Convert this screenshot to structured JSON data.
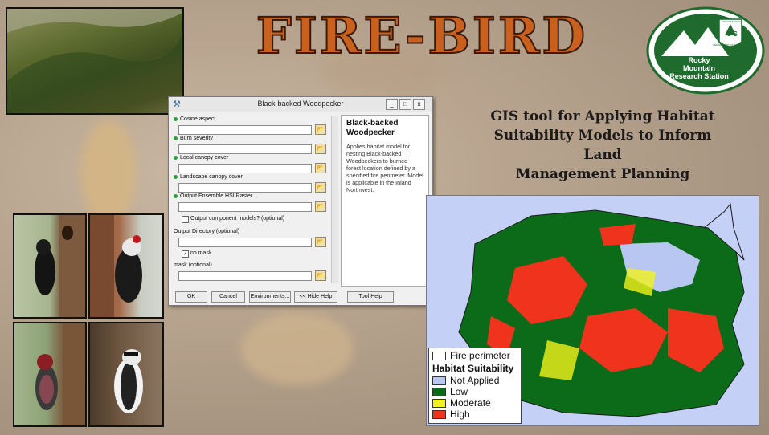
{
  "title": "FIRE-BIRD",
  "subtitle": [
    "GIS tool for Applying Habitat",
    "Suitability Models to Inform Land",
    "Management Planning"
  ],
  "logo": {
    "shield_text": "U S",
    "arc_text_top": "FOREST SERVICE",
    "arc_text_side": "DEPARTMENT OF AGRICULTURE",
    "name_lines": [
      "Rocky",
      "Mountain",
      "Research Station"
    ],
    "colors": {
      "green": "#1f6b2e",
      "white": "#ffffff"
    }
  },
  "dialog": {
    "title": "Black-backed Woodpecker",
    "app_icon": "toolbox-icon",
    "window_buttons": [
      "_",
      "□",
      "x"
    ],
    "fields": [
      {
        "label": "Cosine aspect",
        "required": true,
        "value": ""
      },
      {
        "label": "Burn severity",
        "required": true,
        "value": ""
      },
      {
        "label": "Local canopy cover",
        "required": true,
        "value": ""
      },
      {
        "label": "Landscape canopy cover",
        "required": true,
        "value": ""
      },
      {
        "label": "Output Ensemble HSI Raster",
        "required": true,
        "value": ""
      }
    ],
    "checkbox_component": {
      "label": "Output component models? (optional)",
      "checked": false
    },
    "output_directory": {
      "label": "Output Directory (optional)",
      "value": ""
    },
    "checkbox_nomask": {
      "label": "no mask",
      "checked": true
    },
    "mask": {
      "label": "mask (optional)",
      "value": ""
    },
    "help": {
      "title": "Black-backed Woodpecker",
      "body": "Applies habitat model for nesting Black-backed Woodpeckers to burned forest location defined by a specified fire perimeter. Model is applicable in the Inland Northwest."
    },
    "buttons": {
      "ok": "OK",
      "cancel": "Cancel",
      "environments": "Environments...",
      "hide_help": "<< Hide Help",
      "tool_help": "Tool Help"
    }
  },
  "legend": {
    "perimeter": "Fire perimeter",
    "heading": "Habitat Suitability",
    "items": [
      {
        "label": "Not Applied",
        "color": "#b8c7f2"
      },
      {
        "label": "Low",
        "color": "#0b6a16"
      },
      {
        "label": "Moderate",
        "color": "#f2f21a"
      },
      {
        "label": "High",
        "color": "#f0331d"
      }
    ]
  }
}
